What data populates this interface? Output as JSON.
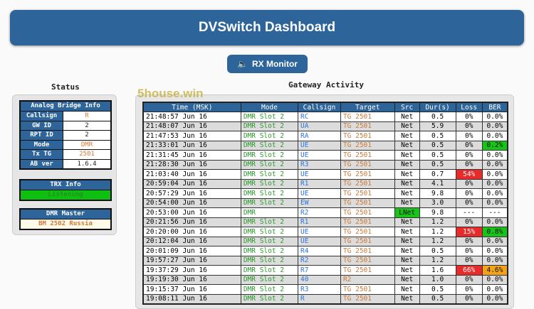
{
  "header": {
    "title": "DVSwitch Dashboard"
  },
  "rx_button": {
    "label": "RX Monitor",
    "icon": "speaker-icon"
  },
  "status": {
    "heading": "Status",
    "analog": {
      "title": "Analog Bridge Info",
      "rows": [
        {
          "k": "Callsign",
          "v": "R"
        },
        {
          "k": "GW ID",
          "v": "2"
        },
        {
          "k": "RPT ID",
          "v": "2"
        },
        {
          "k": "Mode",
          "v": "DMR"
        },
        {
          "k": "Tx TG",
          "v": "2501"
        },
        {
          "k": "AB ver",
          "v": "1.6.4"
        }
      ]
    },
    "trx": {
      "title": "TRX Info",
      "value": "Listening"
    },
    "dmr": {
      "title": "DMR Master",
      "value": "BM 2502 Russia"
    }
  },
  "watermark": "5house.win",
  "activity": {
    "heading": "Gateway Activity",
    "columns": [
      "Time (MSK)",
      "Mode",
      "Callsign",
      "Target",
      "Src",
      "Dur(s)",
      "Loss",
      "BER"
    ],
    "rows": [
      [
        "21:48:57 Jun 16",
        "DMR Slot 2",
        "RC",
        "TG 2501",
        "Net",
        "0.5",
        "0%",
        "0.0%"
      ],
      [
        "21:48:07 Jun 16",
        "DMR Slot 2",
        "UA",
        "TG 2501",
        "Net",
        "5.9",
        "0%",
        "0.0%"
      ],
      [
        "21:47:53 Jun 16",
        "DMR Slot 2",
        "RA",
        "TG 2501",
        "Net",
        "0.5",
        "0%",
        "0.0%"
      ],
      [
        "21:33:01 Jun 16",
        "DMR Slot 2",
        "UE",
        "TG 2501",
        "Net",
        "0.5",
        "0%",
        "0.2%"
      ],
      [
        "21:31:45 Jun 16",
        "DMR Slot 2",
        "UE",
        "TG 2501",
        "Net",
        "0.5",
        "0%",
        "0.0%"
      ],
      [
        "21:28:30 Jun 16",
        "DMR Slot 2",
        "R3",
        "TG 2501",
        "Net",
        "0.5",
        "0%",
        "0.0%"
      ],
      [
        "21:03:40 Jun 16",
        "DMR Slot 2",
        "UE",
        "TG 2501",
        "Net",
        "0.7",
        "54%",
        "0.0%"
      ],
      [
        "20:59:04 Jun 16",
        "DMR Slot 2",
        "R1",
        "TG 2501",
        "Net",
        "4.1",
        "0%",
        "0.0%"
      ],
      [
        "20:57:29 Jun 16",
        "DMR Slot 2",
        "UE",
        "TG 2501",
        "Net",
        "9.8",
        "0%",
        "0.0%"
      ],
      [
        "20:54:00 Jun 16",
        "DMR Slot 2",
        "EW",
        "TG 2501",
        "Net",
        "3.0",
        "0%",
        "0.0%"
      ],
      [
        "20:53:00 Jun 16",
        "DMR",
        "R2",
        "TG 2501",
        "LNet",
        "9.8",
        "---",
        "---"
      ],
      [
        "20:21:56 Jun 16",
        "DMR Slot 2",
        "R1",
        "TG 2501",
        "Net",
        "1.2",
        "0%",
        "0.0%"
      ],
      [
        "20:20:00 Jun 16",
        "DMR Slot 2",
        "UE",
        "TG 2501",
        "Net",
        "1.2",
        "15%",
        "0.8%"
      ],
      [
        "20:12:04 Jun 16",
        "DMR Slot 2",
        "UE",
        "TG 2501",
        "Net",
        "1.2",
        "0%",
        "0.0%"
      ],
      [
        "20:01:09 Jun 16",
        "DMR Slot 2",
        "R4",
        "TG 2501",
        "Net",
        "0.5",
        "0%",
        "0.0%"
      ],
      [
        "19:57:27 Jun 16",
        "DMR Slot 2",
        "R2",
        "TG 2501",
        "Net",
        "1.2",
        "0%",
        "0.0%"
      ],
      [
        "19:37:29 Jun 16",
        "DMR Slot 2",
        "R7",
        "TG 2501",
        "Net",
        "1.6",
        "66%",
        "4.6%"
      ],
      [
        "19:19:30 Jun 16",
        "DMR Slot 2",
        "40",
        "R2",
        "Net",
        "1.0",
        "0%",
        "0.0%"
      ],
      [
        "19:15:37 Jun 16",
        "DMR Slot 2",
        "R3",
        "TG 2501",
        "Net",
        "0.5",
        "0%",
        "0.0%"
      ],
      [
        "19:08:11 Jun 16",
        "DMR Slot 2",
        "R",
        "TG 2501",
        "Net",
        "0.5",
        "0%",
        "0.0%"
      ]
    ],
    "highlights": {
      "3": {
        "7": "grn"
      },
      "6": {
        "6": "red"
      },
      "10": {
        "4": "grn"
      },
      "12": {
        "6": "red",
        "7": "grn"
      },
      "16": {
        "6": "red",
        "7": "amb"
      }
    }
  }
}
